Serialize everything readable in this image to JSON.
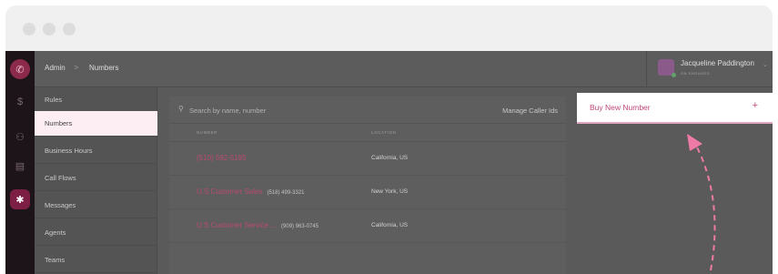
{
  "window": {
    "controls": [
      "close",
      "minimize",
      "maximize"
    ]
  },
  "rail": {
    "icons": [
      {
        "name": "phone-logo-icon",
        "glyph": "✆"
      },
      {
        "name": "dollar-icon",
        "glyph": "$"
      },
      {
        "name": "people-icon",
        "glyph": "⚇"
      },
      {
        "name": "card-icon",
        "glyph": "▤"
      },
      {
        "name": "gear-icon",
        "glyph": "✱"
      }
    ]
  },
  "breadcrumb": {
    "root": "Admin",
    "separator": ">",
    "current": "Numbers"
  },
  "user": {
    "name": "Jacqueline Paddington",
    "status": "ON ENGAGED",
    "caret": "⌄"
  },
  "sidebar": {
    "items": [
      {
        "label": "Rules",
        "active": false
      },
      {
        "label": "Numbers",
        "active": true
      },
      {
        "label": "Business Hours",
        "active": false
      },
      {
        "label": "Call Flows",
        "active": false
      },
      {
        "label": "Messages",
        "active": false
      },
      {
        "label": "Agents",
        "active": false
      },
      {
        "label": "Teams",
        "active": false
      }
    ]
  },
  "search": {
    "icon": "⚲",
    "placeholder": "Search by name, number"
  },
  "manage_caller_ids": "Manage Caller Ids",
  "table": {
    "columns": [
      "NUMBER",
      "LOCATION"
    ],
    "rows": [
      {
        "name": "(510) 592-5195",
        "number": "",
        "location": "California, US"
      },
      {
        "name": "U.S Customer Sales",
        "number": "(518) 499-3321",
        "location": "New York, US"
      },
      {
        "name": "U.S Customer Service ...",
        "number": "(909) 963-0745",
        "location": "California, US"
      }
    ]
  },
  "buy_number": {
    "label": "Buy New Number",
    "plus": "+"
  },
  "colors": {
    "accent": "#c2477a",
    "arrow": "#ee7aa6",
    "rail": "#1c1418"
  }
}
